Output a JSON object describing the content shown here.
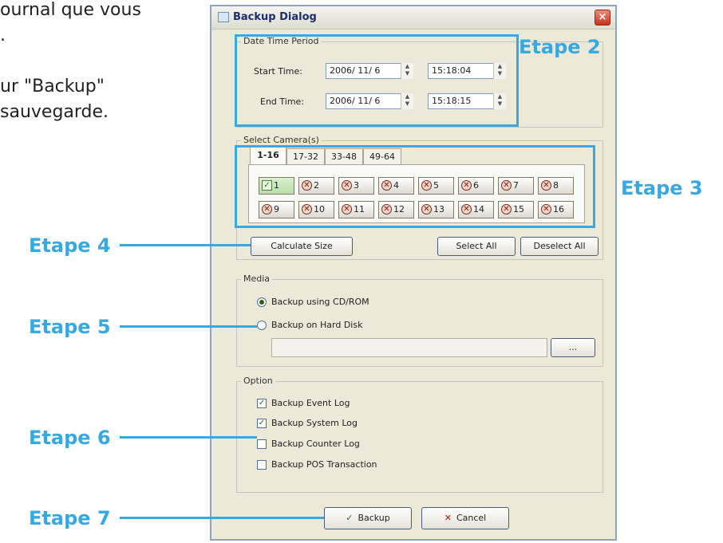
{
  "intro": {
    "line1": "ournal que vous",
    "line2": ".",
    "line3": "ur \"Backup\"",
    "line4": " sauvegarde."
  },
  "callouts": {
    "etape2": "Etape 2",
    "etape3": "Etape 3",
    "etape4": "Etape 4",
    "etape5": "Etape 5",
    "etape6": "Etape 6",
    "etape7": "Etape 7"
  },
  "dialog": {
    "title": "Backup Dialog",
    "close_glyph": "×",
    "datetime_group": {
      "label": "Date Time Period",
      "start_label": "Start Time:",
      "start_date": "2006/ 11/ 6",
      "start_time": "15:18:04",
      "end_label": "End Time:",
      "end_date": "2006/ 11/ 6",
      "end_time": "15:18:15"
    },
    "camera_group": {
      "label": "Select Camera(s)",
      "tabs": [
        "1-16",
        "17-32",
        "33-48",
        "49-64"
      ],
      "row1": [
        "1",
        "2",
        "3",
        "4",
        "5",
        "6",
        "7",
        "8"
      ],
      "row2": [
        "9",
        "10",
        "11",
        "12",
        "13",
        "14",
        "15",
        "16"
      ]
    },
    "buttons": {
      "calculate": "Calculate Size",
      "select_all": "Select All",
      "deselect_all": "Deselect All",
      "browse": "...",
      "backup": "Backup",
      "cancel": "Cancel"
    },
    "media_group": {
      "label": "Media",
      "option1": "Backup using CD/ROM",
      "option2": "Backup on Hard Disk",
      "path": ""
    },
    "option_group": {
      "label": "Option",
      "opt1": "Backup Event Log",
      "opt2": "Backup System Log",
      "opt3": "Backup Counter Log",
      "opt4": "Backup POS Transaction"
    },
    "glyphs": {
      "check": "✓",
      "x": "✕",
      "spin_up": "▲",
      "spin_down": "▼"
    }
  },
  "colors": {
    "callout_blue": "#36a9e1",
    "dialog_face": "#ece9d8"
  }
}
